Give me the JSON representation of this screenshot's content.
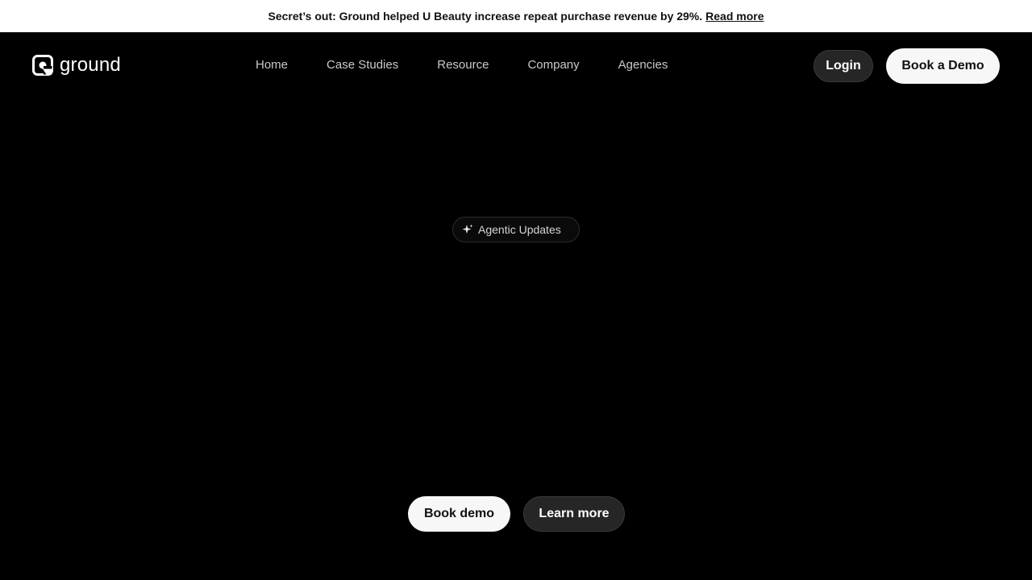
{
  "announcement": {
    "text": "Secret’s out: Ground helped U Beauty increase repeat purchase revenue by 29%.",
    "link_label": "Read more"
  },
  "brand": {
    "name": "ground",
    "icon": "ground-logo-icon"
  },
  "nav": {
    "items": [
      {
        "label": "Home"
      },
      {
        "label": "Case Studies"
      },
      {
        "label": "Resource"
      },
      {
        "label": "Company"
      },
      {
        "label": "Agencies"
      }
    ]
  },
  "header_actions": {
    "login_label": "Login",
    "demo_label": "Book a Demo"
  },
  "hero": {
    "badge_icon": "sparkle-icon",
    "badge_label": "Agentic Updates"
  },
  "cta": {
    "primary_label": "Book demo",
    "secondary_label": "Learn more"
  },
  "colors": {
    "background": "#000000",
    "announcement_bg": "#ffffff",
    "primary_button_bg": "#f7f7f7",
    "secondary_button_bg": "#262626"
  }
}
